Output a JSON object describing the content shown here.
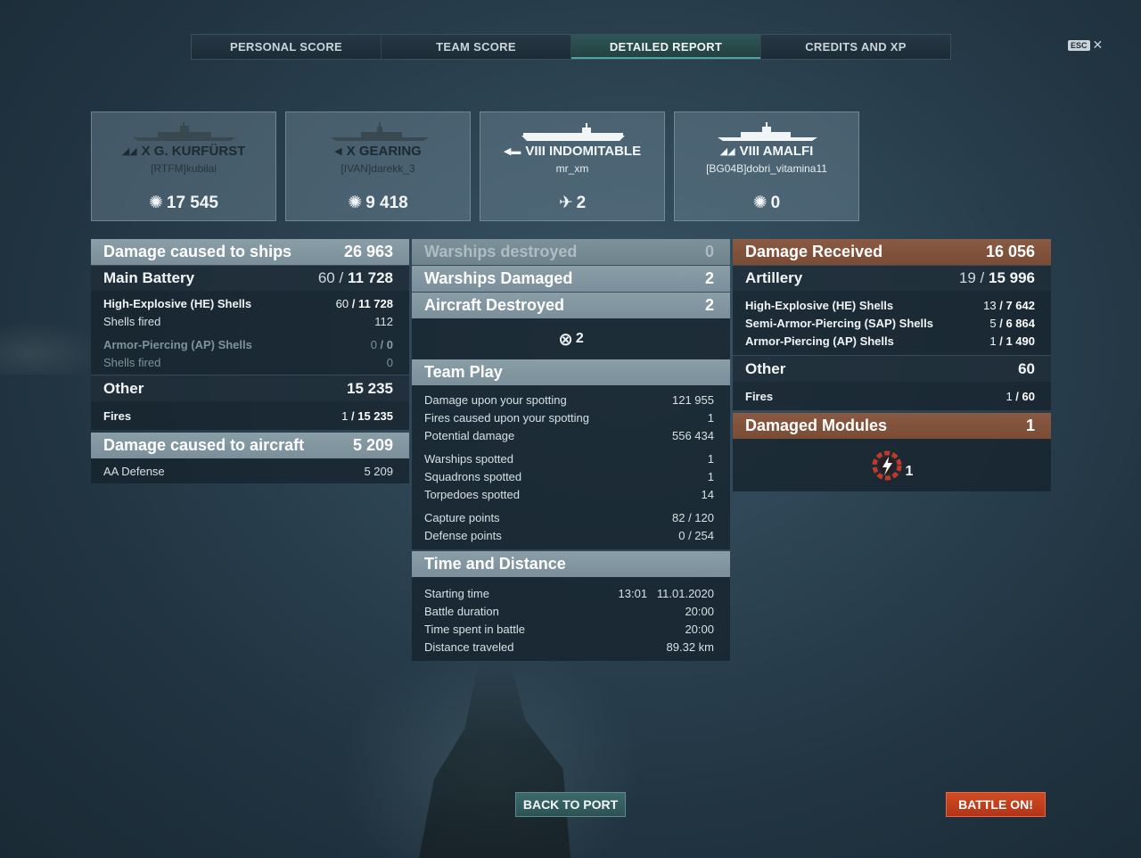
{
  "tabs": [
    {
      "label": "PERSONAL SCORE"
    },
    {
      "label": "TEAM SCORE"
    },
    {
      "label": "DETAILED REPORT"
    },
    {
      "label": "CREDITS AND XP"
    }
  ],
  "esc_label": "ESC",
  "cards": [
    {
      "tier_name": "X G. KURFÜRST",
      "player": "[RTFM]kubilai",
      "score": "17 545",
      "icon": "damage-burst-icon",
      "class_icon": "battleship-icon"
    },
    {
      "tier_name": "X GEARING",
      "player": "[IVAN]darekk_3",
      "score": "9 418",
      "icon": "damage-burst-icon",
      "class_icon": "destroyer-icon"
    },
    {
      "tier_name": "VIII INDOMITABLE",
      "player": "mr_xm",
      "score": "2",
      "icon": "plane-shotdown-icon",
      "class_icon": "carrier-icon"
    },
    {
      "tier_name": "VIII AMALFI",
      "player": "[BG04B]dobri_vitamina11",
      "score": "0",
      "icon": "damage-burst-icon",
      "class_icon": "cruiser-icon"
    }
  ],
  "left": {
    "damage_ships": {
      "label": "Damage caused to ships",
      "value": "26 963"
    },
    "main_battery": {
      "label": "Main Battery",
      "hits": "60",
      "value": "11 728"
    },
    "he_shells": {
      "label": "High-Explosive (HE) Shells",
      "hits": "60",
      "value": "11 728"
    },
    "he_fired": {
      "label": "Shells fired",
      "value": "112"
    },
    "ap_shells": {
      "label": "Armor-Piercing (AP) Shells",
      "hits": "0",
      "value": "0"
    },
    "ap_fired": {
      "label": "Shells fired",
      "value": "0"
    },
    "other": {
      "label": "Other",
      "value": "15 235"
    },
    "fires": {
      "label": "Fires",
      "hits": "1",
      "value": "15 235"
    },
    "damage_aircraft": {
      "label": "Damage caused to aircraft",
      "value": "5 209"
    },
    "aa_defense": {
      "label": "AA Defense",
      "value": "5 209"
    }
  },
  "middle": {
    "warships_destroyed": {
      "label": "Warships destroyed",
      "value": "0"
    },
    "warships_damaged": {
      "label": "Warships Damaged",
      "value": "2"
    },
    "aircraft_destroyed": {
      "label": "Aircraft Destroyed",
      "value": "2"
    },
    "aircraft_icon_count": "2",
    "team_play": {
      "title": "Team Play",
      "rows": [
        {
          "label": "Damage upon your spotting",
          "value": "121 955"
        },
        {
          "label": "Fires caused upon your spotting",
          "value": "1"
        },
        {
          "label": "Potential damage",
          "value": "556 434"
        },
        {
          "label": "Warships spotted",
          "value": "1"
        },
        {
          "label": "Squadrons spotted",
          "value": "1"
        },
        {
          "label": "Torpedoes spotted",
          "value": "14"
        },
        {
          "label": "Capture points",
          "value": "82 / 120"
        },
        {
          "label": "Defense points",
          "value": "0 / 254"
        }
      ]
    },
    "time_distance": {
      "title": "Time and Distance",
      "rows": [
        {
          "label": "Starting time",
          "value": "13:01   11.01.2020"
        },
        {
          "label": "Battle duration",
          "value": "20:00"
        },
        {
          "label": "Time spent in battle",
          "value": "20:00"
        },
        {
          "label": "Distance traveled",
          "value": "89.32 km"
        }
      ]
    }
  },
  "right": {
    "damage_received": {
      "label": "Damage Received",
      "value": "16 056"
    },
    "artillery": {
      "label": "Artillery",
      "hits": "19",
      "value": "15 996"
    },
    "he_shells": {
      "label": "High-Explosive (HE) Shells",
      "hits": "13",
      "value": "7 642"
    },
    "sap_shells": {
      "label": "Semi-Armor-Piercing (SAP) Shells",
      "hits": "5",
      "value": "6 864"
    },
    "ap_shells": {
      "label": "Armor-Piercing (AP) Shells",
      "hits": "1",
      "value": "1 490"
    },
    "other": {
      "label": "Other",
      "value": "60"
    },
    "fires": {
      "label": "Fires",
      "hits": "1",
      "value": "60"
    },
    "damaged_modules": {
      "label": "Damaged Modules",
      "value": "1"
    },
    "module_icon_count": "1"
  },
  "buttons": {
    "back_to_port": "BACK TO PORT",
    "battle_on": "BATTLE ON!"
  },
  "colors": {
    "accent_teal": "#4fa3a0",
    "header_gray": "#7a8f99",
    "header_brown": "#7a4c36",
    "battle_button": "#c23f1e"
  }
}
